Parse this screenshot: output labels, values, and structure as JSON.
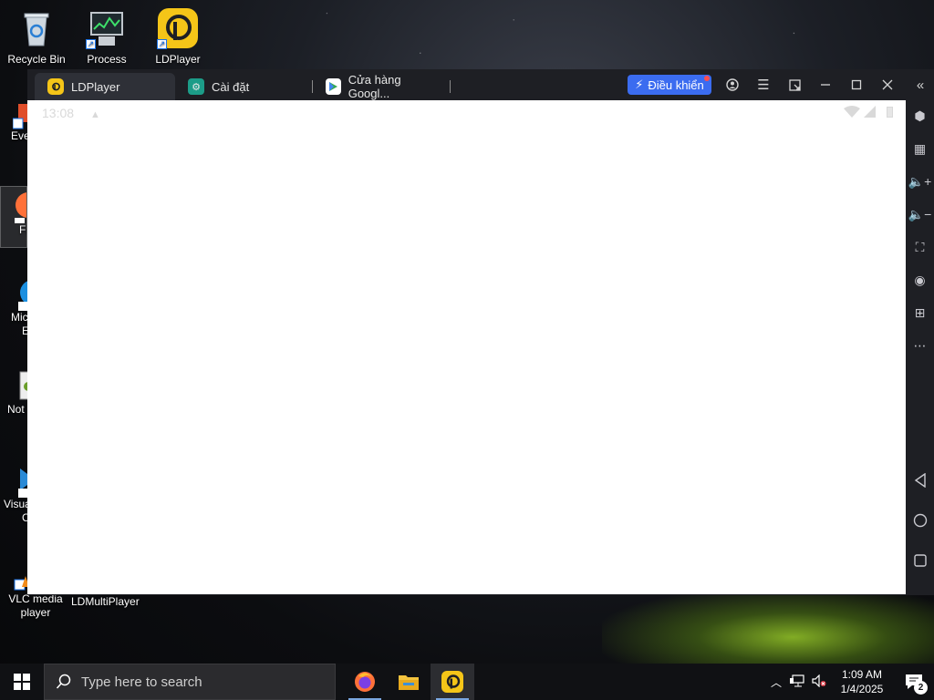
{
  "desktop": {
    "top_icons": [
      {
        "label": "Recycle Bin",
        "icon": "recycle-bin-icon"
      },
      {
        "label": "Process",
        "icon": "process-monitor-icon"
      },
      {
        "label": "LDPlayer",
        "icon": "ldplayer-icon"
      }
    ],
    "left_icons": [
      {
        "label": "Eve",
        "icon": "app-icon"
      },
      {
        "label": "Fi",
        "icon": "firefox-icon"
      },
      {
        "label": "Mic",
        "label2": "E",
        "icon": "edge-icon"
      },
      {
        "label": "Not",
        "icon": "notepad-icon"
      },
      {
        "label": "Visua",
        "label2": "C",
        "icon": "vscode-icon"
      }
    ],
    "bottom_icons": [
      {
        "label": "VLC media",
        "label2": "player"
      },
      {
        "label": "LDMultiPlayer"
      }
    ]
  },
  "window": {
    "tabs": [
      {
        "label": "LDPlayer",
        "icon": "ldplayer-icon",
        "active": true
      },
      {
        "label": "Cài đặt",
        "icon": "settings-gear-icon",
        "active": false
      },
      {
        "label": "Cửa hàng Googl...",
        "icon": "play-store-icon",
        "active": false
      }
    ],
    "controls": {
      "dieu_khien": "Điều khiển",
      "account": "account-icon",
      "menu": "hamburger-icon",
      "restore_aspect": "resize-icon",
      "minimize": "minimize-icon",
      "maximize": "maximize-icon",
      "close": "close-icon",
      "collapse": "double-chevron-left-icon"
    },
    "android_status": {
      "time": "13:08"
    },
    "sidebar_buttons": [
      "gamepad-icon",
      "keyboard-icon",
      "volume-up-icon",
      "volume-down-icon",
      "fullscreen-icon",
      "apk-install-icon",
      "add-folder-icon",
      "more-icon",
      "back-icon",
      "home-icon",
      "recents-icon"
    ]
  },
  "taskbar": {
    "search_placeholder": "Type here to search",
    "apps": [
      "firefox-icon",
      "file-explorer-icon",
      "ldplayer-icon"
    ],
    "clock_time": "1:09 AM",
    "clock_date": "1/4/2025",
    "notification_count": "2"
  },
  "colors": {
    "accent": "#3b6cf0",
    "ld_yellow": "#f5c518",
    "window_bg": "#1e1f24"
  }
}
